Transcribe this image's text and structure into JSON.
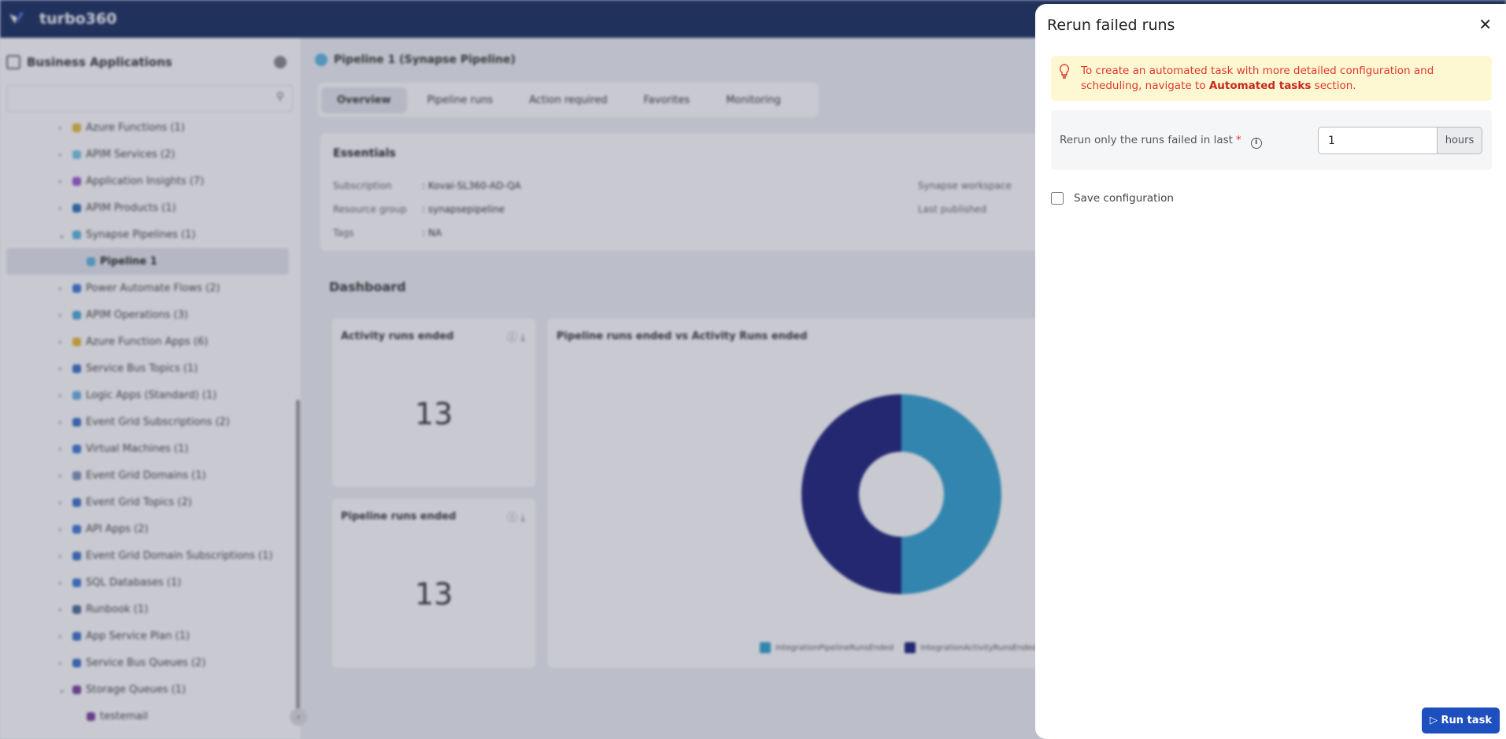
{
  "app": {
    "brand": "turbo360"
  },
  "sidebar": {
    "title": "Business Applications",
    "search_placeholder": "",
    "items": [
      {
        "label": "Azure Functions (1)",
        "color": "#e8b93a",
        "expanded": false
      },
      {
        "label": "APIM Services (2)",
        "color": "#7cc5e6",
        "expanded": false
      },
      {
        "label": "Application Insights (7)",
        "color": "#9b59d0",
        "expanded": false
      },
      {
        "label": "APIM Products (1)",
        "color": "#2d6fb7",
        "expanded": false
      },
      {
        "label": "Synapse Pipelines (1)",
        "color": "#5ab4e0",
        "expanded": true
      },
      {
        "label": "Pipeline 1",
        "color": "#5ab4e0",
        "child": true,
        "selected": true
      },
      {
        "label": "Power Automate Flows (2)",
        "color": "#3b78d8",
        "expanded": false
      },
      {
        "label": "APIM Operations (3)",
        "color": "#4aa8d8",
        "expanded": false
      },
      {
        "label": "Azure Function Apps (6)",
        "color": "#e8b93a",
        "expanded": false
      },
      {
        "label": "Service Bus Topics (1)",
        "color": "#3a6fc9",
        "expanded": false
      },
      {
        "label": "Logic Apps (Standard) (1)",
        "color": "#6aaee8",
        "expanded": false
      },
      {
        "label": "Event Grid Subscriptions (2)",
        "color": "#3a6fc9",
        "expanded": false
      },
      {
        "label": "Virtual Machines (1)",
        "color": "#3a78d8",
        "expanded": false
      },
      {
        "label": "Event Grid Domains (1)",
        "color": "#7b8fb8",
        "expanded": false
      },
      {
        "label": "Event Grid Topics (2)",
        "color": "#3a6fc9",
        "expanded": false
      },
      {
        "label": "API Apps (2)",
        "color": "#3a78d8",
        "expanded": false
      },
      {
        "label": "Event Grid Domain Subscriptions (1)",
        "color": "#3a6fc9",
        "expanded": false
      },
      {
        "label": "SQL Databases (1)",
        "color": "#3a78d8",
        "expanded": false
      },
      {
        "label": "Runbook (1)",
        "color": "#4a6a9a",
        "expanded": false
      },
      {
        "label": "App Service Plan (1)",
        "color": "#3a6fc9",
        "expanded": false
      },
      {
        "label": "Service Bus Queues (2)",
        "color": "#3a6fc9",
        "expanded": false
      },
      {
        "label": "Storage Queues (1)",
        "color": "#7a3fa0",
        "expanded": true
      },
      {
        "label": "testemail",
        "color": "#7a3fa0",
        "child": true
      }
    ]
  },
  "main": {
    "title": "Pipeline 1 (Synapse Pipeline)",
    "tabs": [
      "Overview",
      "Pipeline runs",
      "Action required",
      "Favorites",
      "Monitoring"
    ],
    "essentials": {
      "title": "Essentials",
      "subscription_label": "Subscription",
      "subscription": ": Kovai-SL360-AD-QA",
      "rg_label": "Resource group",
      "rg": ": synapsepipeline",
      "tags_label": "Tags",
      "tags": ": NA",
      "workspace_label": "Synapse workspace",
      "published_label": "Last published"
    },
    "dashboard": {
      "title": "Dashboard",
      "activity_title": "Activity runs ended",
      "activity_value": "13",
      "pipeline_title": "Pipeline runs ended",
      "pipeline_value": "13"
    }
  },
  "chart_data": {
    "type": "pie",
    "title": "Pipeline runs ended vs Activity Runs ended",
    "categories": [
      "IntegrationPipelineRunsEnded",
      "IntegrationActivityRunsEnded"
    ],
    "values": [
      13,
      13
    ],
    "colors": [
      "#2fa0cf",
      "#1a1f7a"
    ],
    "donut": true,
    "legend": "bottom"
  },
  "panel": {
    "title": "Rerun failed runs",
    "alert_pre": "To create an automated task with more detailed configuration and scheduling, navigate to ",
    "alert_link": "Automated tasks",
    "alert_post": " section.",
    "field_label": "Rerun only the runs failed in last",
    "required": "*",
    "field_value": "1",
    "unit": "hours",
    "save_label": "Save configuration",
    "save_checked": false,
    "run_label": "Run task"
  }
}
